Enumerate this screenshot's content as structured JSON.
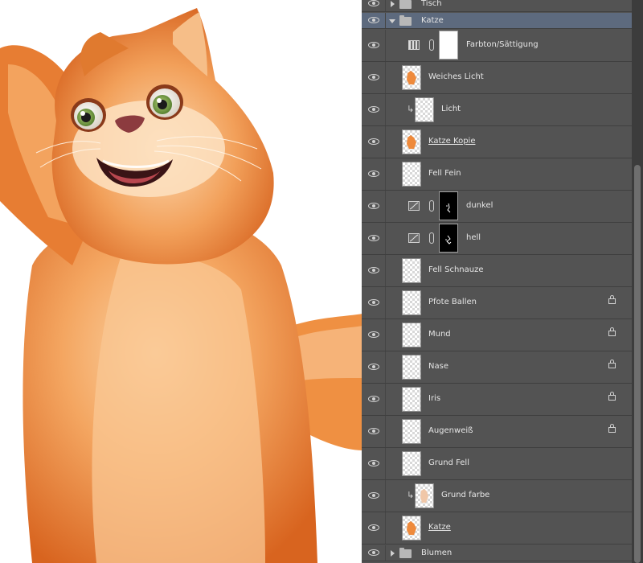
{
  "canvas": {
    "artwork_subject": "cat-illustration",
    "colors": {
      "fur_light": "#f9b778",
      "fur_mid": "#ee8a3c",
      "fur_dark": "#c9541b",
      "eye_iris": "#6f9a3a",
      "mouth": "#3a1416"
    }
  },
  "layers_panel": {
    "colors": {
      "panel_bg": "#535353",
      "selected_bg": "#5d6a7e",
      "text": "#e6e6e6"
    },
    "layers": [
      {
        "name": "Tisch",
        "kind": "group",
        "expanded": false
      },
      {
        "name": "Katze",
        "kind": "group",
        "expanded": true,
        "selected": true
      },
      {
        "name": "Farbton/Sättigung",
        "kind": "adjustment",
        "icon": "hue-saturation-icon",
        "mask": "white"
      },
      {
        "name": "Weiches Licht",
        "kind": "layer",
        "thumb": "cat"
      },
      {
        "name": "Licht",
        "kind": "layer",
        "clipped": true,
        "thumb": "empty"
      },
      {
        "name": "Katze Kopie ",
        "kind": "layer",
        "thumb": "cat",
        "underlined": true
      },
      {
        "name": "Fell Fein",
        "kind": "layer",
        "thumb": "empty"
      },
      {
        "name": "dunkel",
        "kind": "adjustment",
        "icon": "curves-icon",
        "mask": "black"
      },
      {
        "name": "hell",
        "kind": "adjustment",
        "icon": "curves-icon",
        "mask": "black"
      },
      {
        "name": "Fell Schnauze",
        "kind": "layer",
        "thumb": "empty"
      },
      {
        "name": "Pfote Ballen",
        "kind": "layer",
        "thumb": "empty",
        "locked": true
      },
      {
        "name": "Mund",
        "kind": "layer",
        "thumb": "empty",
        "locked": true
      },
      {
        "name": "Nase",
        "kind": "layer",
        "thumb": "empty",
        "locked": true
      },
      {
        "name": "Iris",
        "kind": "layer",
        "thumb": "empty",
        "locked": true
      },
      {
        "name": "Augenweiß",
        "kind": "layer",
        "thumb": "empty",
        "locked": true
      },
      {
        "name": "Grund Fell",
        "kind": "layer",
        "thumb": "empty"
      },
      {
        "name": "Grund farbe",
        "kind": "layer",
        "clipped": true,
        "thumb": "sketch"
      },
      {
        "name": "Katze ",
        "kind": "layer",
        "thumb": "cat",
        "underlined": true
      },
      {
        "name": "Blumen",
        "kind": "group",
        "expanded": false
      }
    ]
  }
}
